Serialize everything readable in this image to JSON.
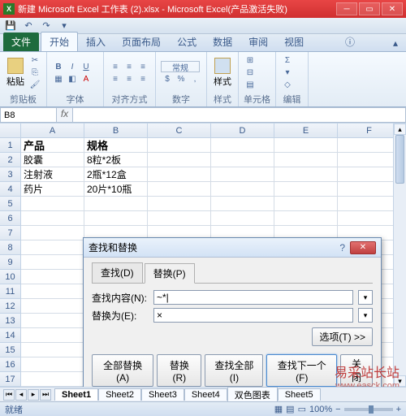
{
  "title": "新建 Microsoft Excel 工作表 (2).xlsx - Microsoft Excel(产品激活失败)",
  "qat": {
    "save": "💾",
    "undo": "↶",
    "redo": "↷"
  },
  "tabs": {
    "file": "文件",
    "items": [
      "开始",
      "插入",
      "页面布局",
      "公式",
      "数据",
      "审阅",
      "视图"
    ],
    "active": 0,
    "help": "ⓘ"
  },
  "ribbon": {
    "groups": [
      {
        "label": "剪贴板",
        "big": "粘贴"
      },
      {
        "label": "字体"
      },
      {
        "label": "对齐方式"
      },
      {
        "label": "数字",
        "big": "常规"
      },
      {
        "label": "样式",
        "big": "样式"
      },
      {
        "label": "单元格"
      },
      {
        "label": "编辑"
      }
    ]
  },
  "namebox": "B8",
  "columns": [
    "A",
    "B",
    "C",
    "D",
    "E",
    "F"
  ],
  "rows": [
    {
      "n": 1,
      "A": "产品",
      "B": "规格",
      "bold": true
    },
    {
      "n": 2,
      "A": "胶囊",
      "B": "8粒*2板"
    },
    {
      "n": 3,
      "A": "注射液",
      "B": "2瓶*12盒"
    },
    {
      "n": 4,
      "A": "药片",
      "B": "20片*10瓶"
    },
    {
      "n": 5
    },
    {
      "n": 6
    },
    {
      "n": 7
    },
    {
      "n": 8
    },
    {
      "n": 9
    },
    {
      "n": 10
    },
    {
      "n": 11
    },
    {
      "n": 12
    },
    {
      "n": 13
    },
    {
      "n": 14
    },
    {
      "n": 15
    },
    {
      "n": 16
    },
    {
      "n": 17
    }
  ],
  "selection": {
    "row": 8,
    "col": "B"
  },
  "dialog": {
    "title": "查找和替换",
    "tabs": [
      "查找(D)",
      "替换(P)"
    ],
    "active_tab": 1,
    "find_label": "查找内容(N):",
    "find_value": "~*|",
    "replace_label": "替换为(E):",
    "replace_value": "×",
    "options": "选项(T) >>",
    "buttons": [
      "全部替换(A)",
      "替换(R)",
      "查找全部(I)",
      "查找下一个(F)",
      "关闭"
    ]
  },
  "sheets": [
    "Sheet1",
    "Sheet2",
    "Sheet3",
    "Sheet4",
    "双色图表",
    "Sheet5"
  ],
  "active_sheet": 0,
  "status": {
    "mode": "就绪",
    "zoom": "100%"
  },
  "watermark": {
    "main": "易采站长站",
    "sub": "www.easck.com"
  }
}
